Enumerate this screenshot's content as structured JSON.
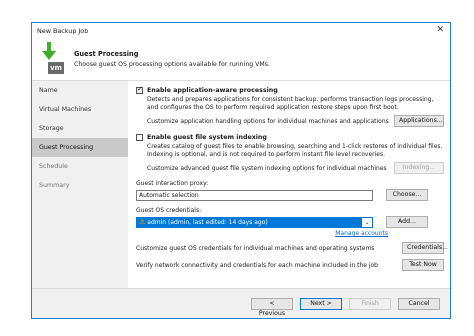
{
  "window": {
    "title": "New Backup Job"
  },
  "header": {
    "title": "Guest Processing",
    "subtitle": "Choose guest OS processing options available for running VMs.",
    "icon_text": "vm"
  },
  "sidebar": {
    "items": [
      {
        "label": "Name",
        "state": "normal"
      },
      {
        "label": "Virtual Machines",
        "state": "normal"
      },
      {
        "label": "Storage",
        "state": "normal"
      },
      {
        "label": "Guest Processing",
        "state": "active"
      },
      {
        "label": "Schedule",
        "state": "disabled"
      },
      {
        "label": "Summary",
        "state": "disabled"
      }
    ]
  },
  "app_aware": {
    "checked": true,
    "label": "Enable application-aware processing",
    "description": "Detects and prepares applications for consistent backup, performs transaction logs processing, and configures the OS to perform required application restore steps upon first boot.",
    "option_text": "Customize application handling options for individual machines and applications",
    "button": "Applications..."
  },
  "fs_index": {
    "checked": false,
    "label": "Enable guest file system indexing",
    "description": "Creates catalog of guest files to enable browsing, searching and 1-click restores of individual files. Indexing is optional, and is not required to perform instant file level recoveries.",
    "option_text": "Customize advanced guest file system indexing options for individual machines",
    "button": "Indexing..."
  },
  "proxy": {
    "label": "Guest interaction proxy:",
    "value": "Automatic selection",
    "button": "Choose..."
  },
  "credentials": {
    "label": "Guest OS credentials:",
    "value": "admin (admin, last edited: 14 days ago)",
    "button": "Add...",
    "link": "Manage accounts"
  },
  "custom_creds": {
    "text": "Customize guest OS credentials for individual machines and operating systems",
    "button": "Credentials..."
  },
  "verify": {
    "text": "Verify network connectivity and credentials for each machine included in the job",
    "button": "Test Now"
  },
  "footer": {
    "previous": "< Previous",
    "next": "Next >",
    "finish": "Finish",
    "cancel": "Cancel"
  },
  "colors": {
    "accent": "#0078d7",
    "link": "#0066cc",
    "icon_green": "#3fae2a"
  }
}
